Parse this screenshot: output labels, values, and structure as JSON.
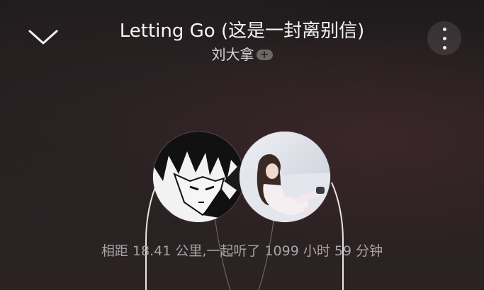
{
  "header": {
    "collapse_icon": "chevron-down-icon",
    "more_icon": "more-vertical-icon",
    "song_title": "Letting Go (这是一封离别信)",
    "artist": "刘大拿",
    "follow_badge": "+"
  },
  "listen_together": {
    "left_avatar": "avatar-anime-boy",
    "right_avatar": "avatar-girl-snow",
    "headphone_icon": "headphones-icon",
    "stats_text": "相距 18.41 公里,一起听了 1099 小时 59 分钟"
  },
  "colors": {
    "background": "#241e1f",
    "title": "#f4f4f4",
    "subtle_text": "#a9a4a5",
    "badge": "#6b6566"
  }
}
